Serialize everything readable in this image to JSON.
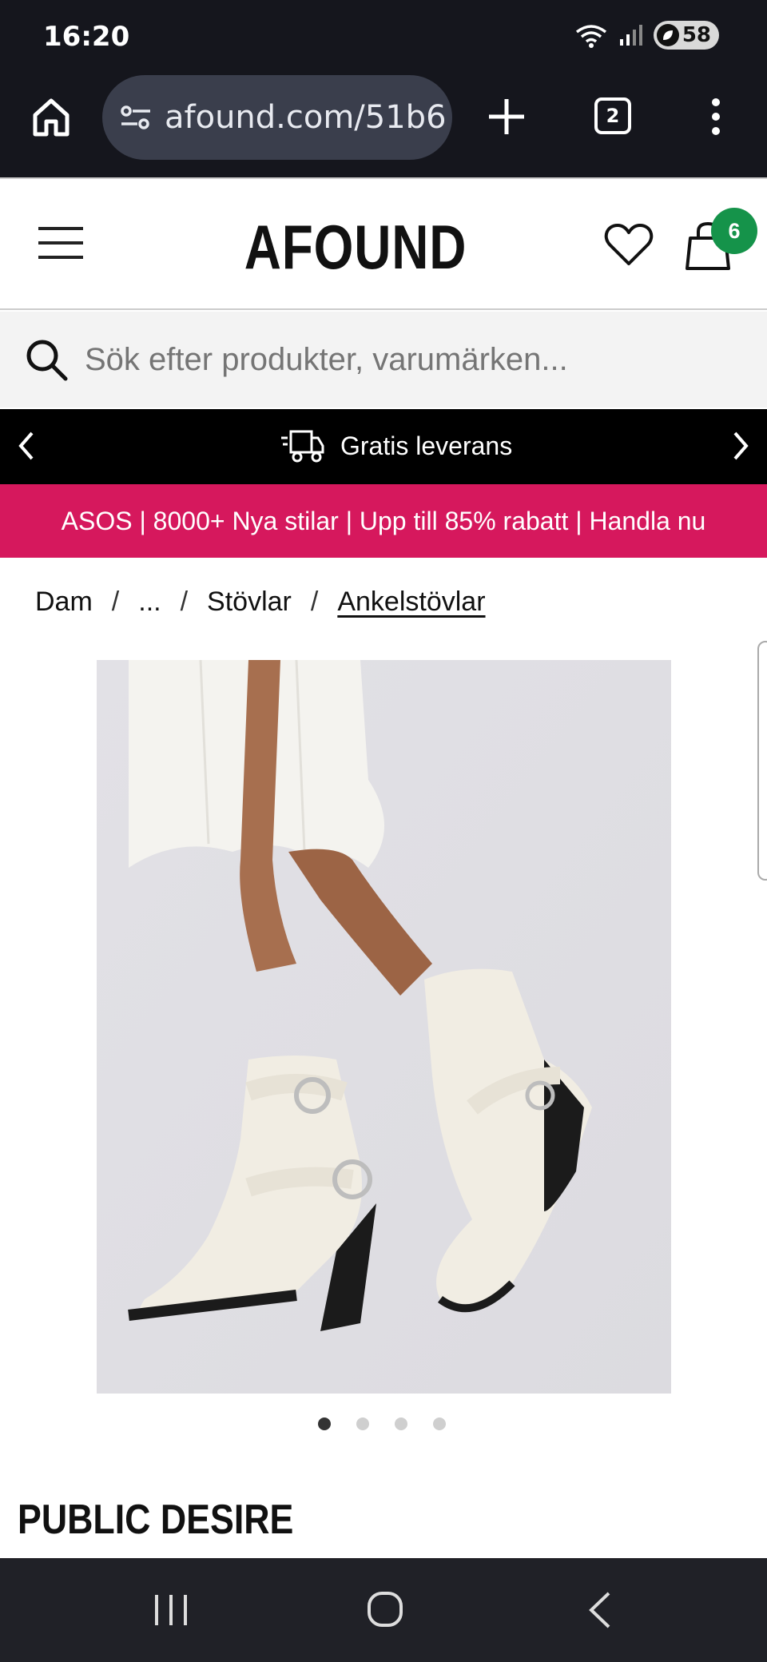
{
  "status_bar": {
    "time": "16:20",
    "battery": "58"
  },
  "browser": {
    "url": "afound.com/51b6",
    "tab_count": "2"
  },
  "header": {
    "logo": "AFOUND",
    "cart_count": "6"
  },
  "search": {
    "placeholder": "Sök efter produkter, varumärken..."
  },
  "delivery_banner": {
    "text": "Gratis leverans"
  },
  "promo_banner": {
    "text": "ASOS | 8000+ Nya stilar | Upp till 85% rabatt | Handla nu"
  },
  "breadcrumb": {
    "items": [
      "Dam",
      "...",
      "Stövlar",
      "Ankelstövlar"
    ]
  },
  "carousel": {
    "count": 4,
    "active": 0
  },
  "product": {
    "brand": "PUBLIC DESIRE"
  },
  "colors": {
    "promo": "#d6185d",
    "badge": "#15934a",
    "chrome": "#15161d"
  }
}
